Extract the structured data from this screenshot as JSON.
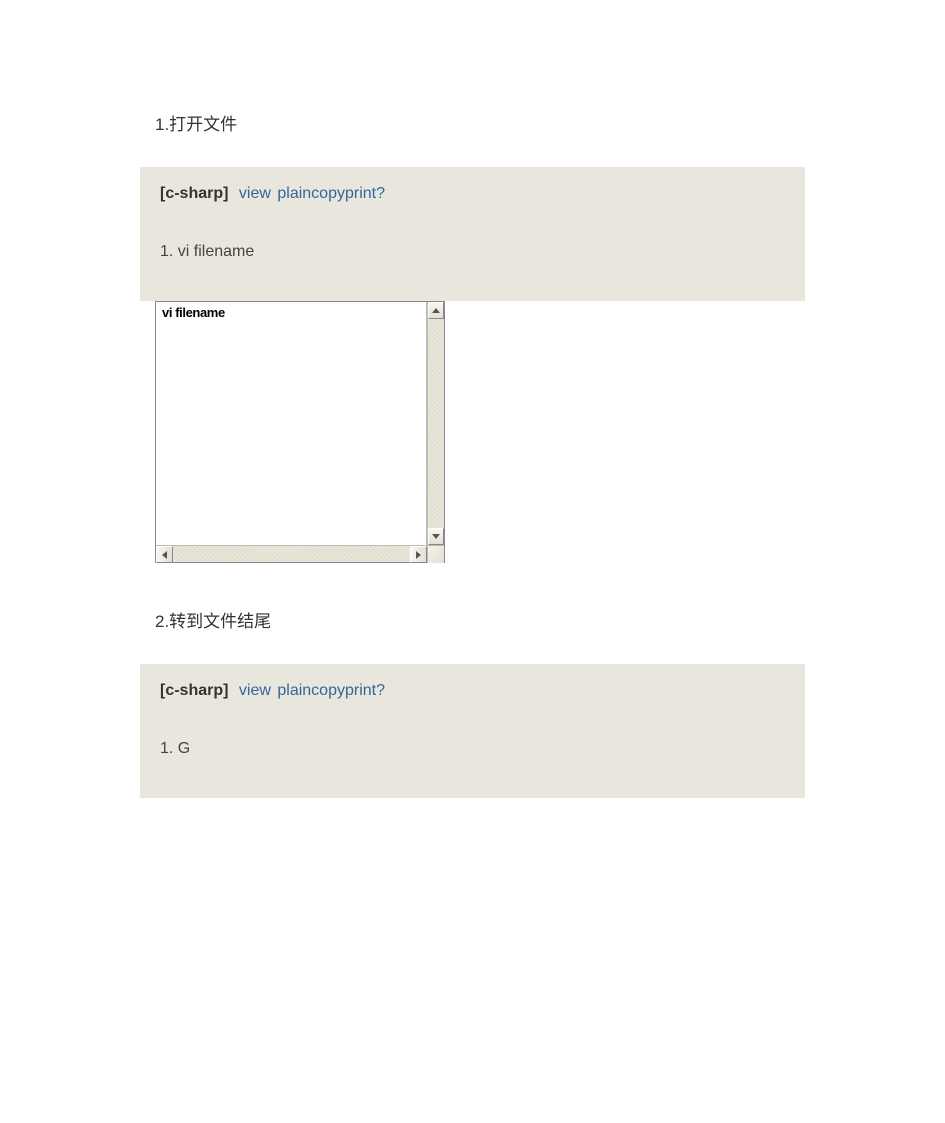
{
  "sections": [
    {
      "title": "1.打开文件",
      "lang_label": "[c-sharp]",
      "links": {
        "view": "view",
        "rest": "plaincopyprint?"
      },
      "code": {
        "num": "1.",
        "text": "vi  filename"
      }
    },
    {
      "title": "2.转到文件结尾",
      "lang_label": "[c-sharp]",
      "links": {
        "view": "view",
        "rest": "plaincopyprint?"
      },
      "code": {
        "num": "1.",
        "text": "G"
      }
    }
  ],
  "scrollbox": {
    "text": "vi filename"
  }
}
